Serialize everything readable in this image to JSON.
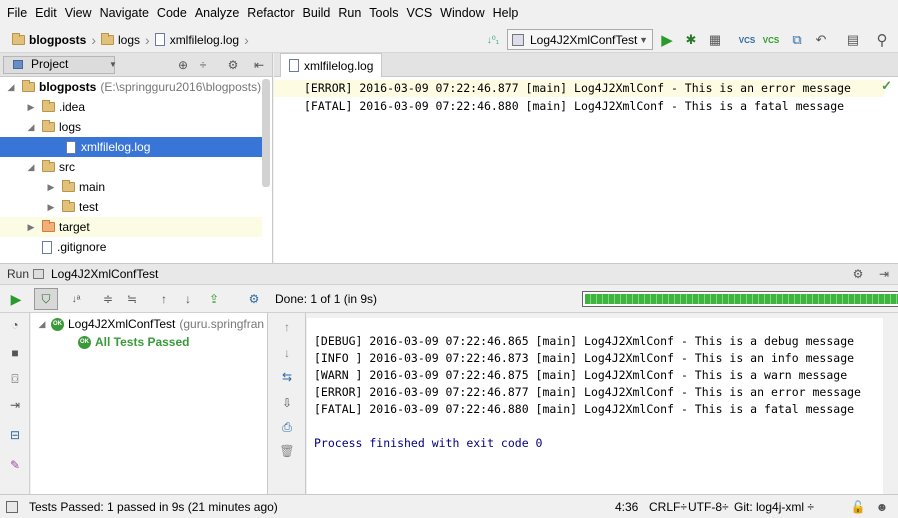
{
  "menu": [
    "File",
    "Edit",
    "View",
    "Navigate",
    "Code",
    "Analyze",
    "Refactor",
    "Build",
    "Run",
    "Tools",
    "VCS",
    "Window",
    "Help"
  ],
  "breadcrumb": {
    "project": "blogposts",
    "folder": "logs",
    "file": "xmlfilelog.log"
  },
  "run_config": "Log4J2XmlConfTest",
  "project_panel": {
    "title": "Project",
    "root_name": "blogposts",
    "root_path": "(E:\\springguru2016\\blogposts)",
    "items": [
      {
        "label": ".idea"
      },
      {
        "label": "logs"
      },
      {
        "label": "xmlfilelog.log"
      },
      {
        "label": "src"
      },
      {
        "label": "main"
      },
      {
        "label": "test"
      },
      {
        "label": "target"
      },
      {
        "label": ".gitignore"
      }
    ]
  },
  "editor": {
    "tab": "xmlfilelog.log",
    "lines": [
      "[ERROR] 2016-03-09 07:22:46.877 [main] Log4J2XmlConf - This is an error message",
      "[FATAL] 2016-03-09 07:22:46.880 [main] Log4J2XmlConf - This is a fatal message"
    ]
  },
  "run_panel": {
    "label": "Run",
    "config": "Log4J2XmlConfTest",
    "done": "Done: 1 of 1 (in 9s)",
    "progress": 1.0
  },
  "test_tree": {
    "root": "Log4J2XmlConfTest",
    "root_pkg": "(guru.springfran",
    "ok": "OK",
    "passed": "All Tests Passed"
  },
  "console": {
    "lines": [
      "[DEBUG] 2016-03-09 07:22:46.865 [main] Log4J2XmlConf - This is a debug message",
      "[INFO ] 2016-03-09 07:22:46.873 [main] Log4J2XmlConf - This is an info message",
      "[WARN ] 2016-03-09 07:22:46.875 [main] Log4J2XmlConf - This is a warn message",
      "[ERROR] 2016-03-09 07:22:46.877 [main] Log4J2XmlConf - This is an error message",
      "[FATAL] 2016-03-09 07:22:46.880 [main] Log4J2XmlConf - This is a fatal message"
    ],
    "exit": "Process finished with exit code 0"
  },
  "status": {
    "message": "Tests Passed: 1 passed in 9s (21 minutes ago)",
    "position": "4:36",
    "line_sep": "CRLF÷",
    "encoding": "UTF-8÷",
    "git": "Git: log4j-xml ÷"
  },
  "colors": {
    "accent": "#3875d7",
    "ok": "#3a9a3a",
    "console_text": "#000080",
    "progress": "#3fb53f"
  }
}
